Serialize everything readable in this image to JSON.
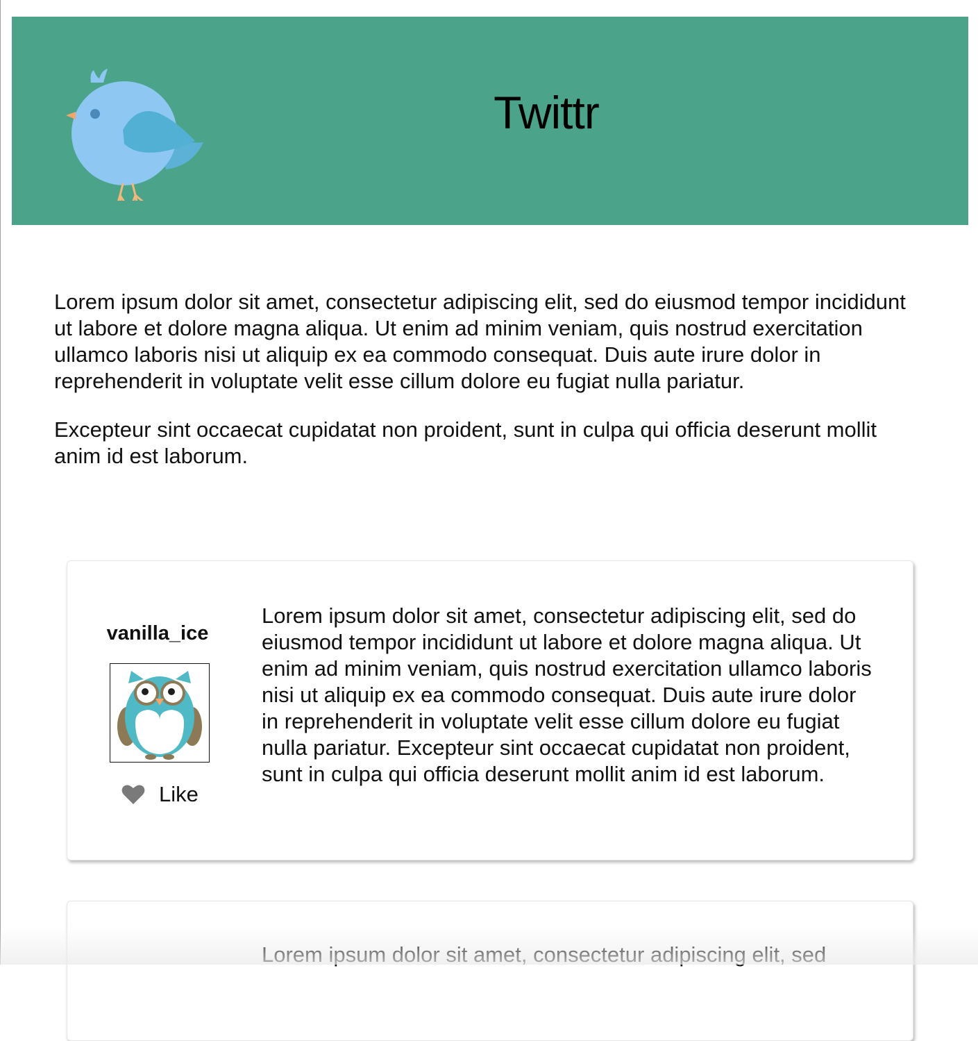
{
  "header": {
    "title": "Twittr",
    "background_color": "#4ba489",
    "logo_icon": "bird-icon"
  },
  "intro": {
    "paragraphs": [
      "Lorem ipsum dolor sit amet, consectetur adipiscing elit, sed do eiusmod tempor incididunt ut labore et dolore magna aliqua. Ut enim ad minim veniam, quis nostrud exercitation ullamco laboris nisi ut aliquip ex ea commodo consequat. Duis aute irure dolor in reprehenderit in voluptate velit esse cillum dolore eu fugiat nulla pariatur.",
      "Excepteur sint occaecat cupidatat non proident, sunt in culpa qui officia deserunt mollit anim id est laborum."
    ]
  },
  "tweets": [
    {
      "username": "vanilla_ice",
      "avatar_icon": "owl-avatar-icon",
      "like_label": "Like",
      "text": "Lorem ipsum dolor sit amet, consectetur adipiscing elit, sed do eiusmod tempor incididunt ut labore et dolore magna aliqua. Ut enim ad minim veniam, quis nostrud exercitation ullamco laboris nisi ut aliquip ex ea commodo consequat. Duis aute irure dolor in reprehenderit in voluptate velit esse cillum dolore eu fugiat nulla pariatur. Excepteur sint occaecat cupidatat non proident, sunt in culpa qui officia deserunt mollit anim id est laborum."
    },
    {
      "text": "Lorem ipsum dolor sit amet, consectetur adipiscing elit, sed"
    }
  ]
}
